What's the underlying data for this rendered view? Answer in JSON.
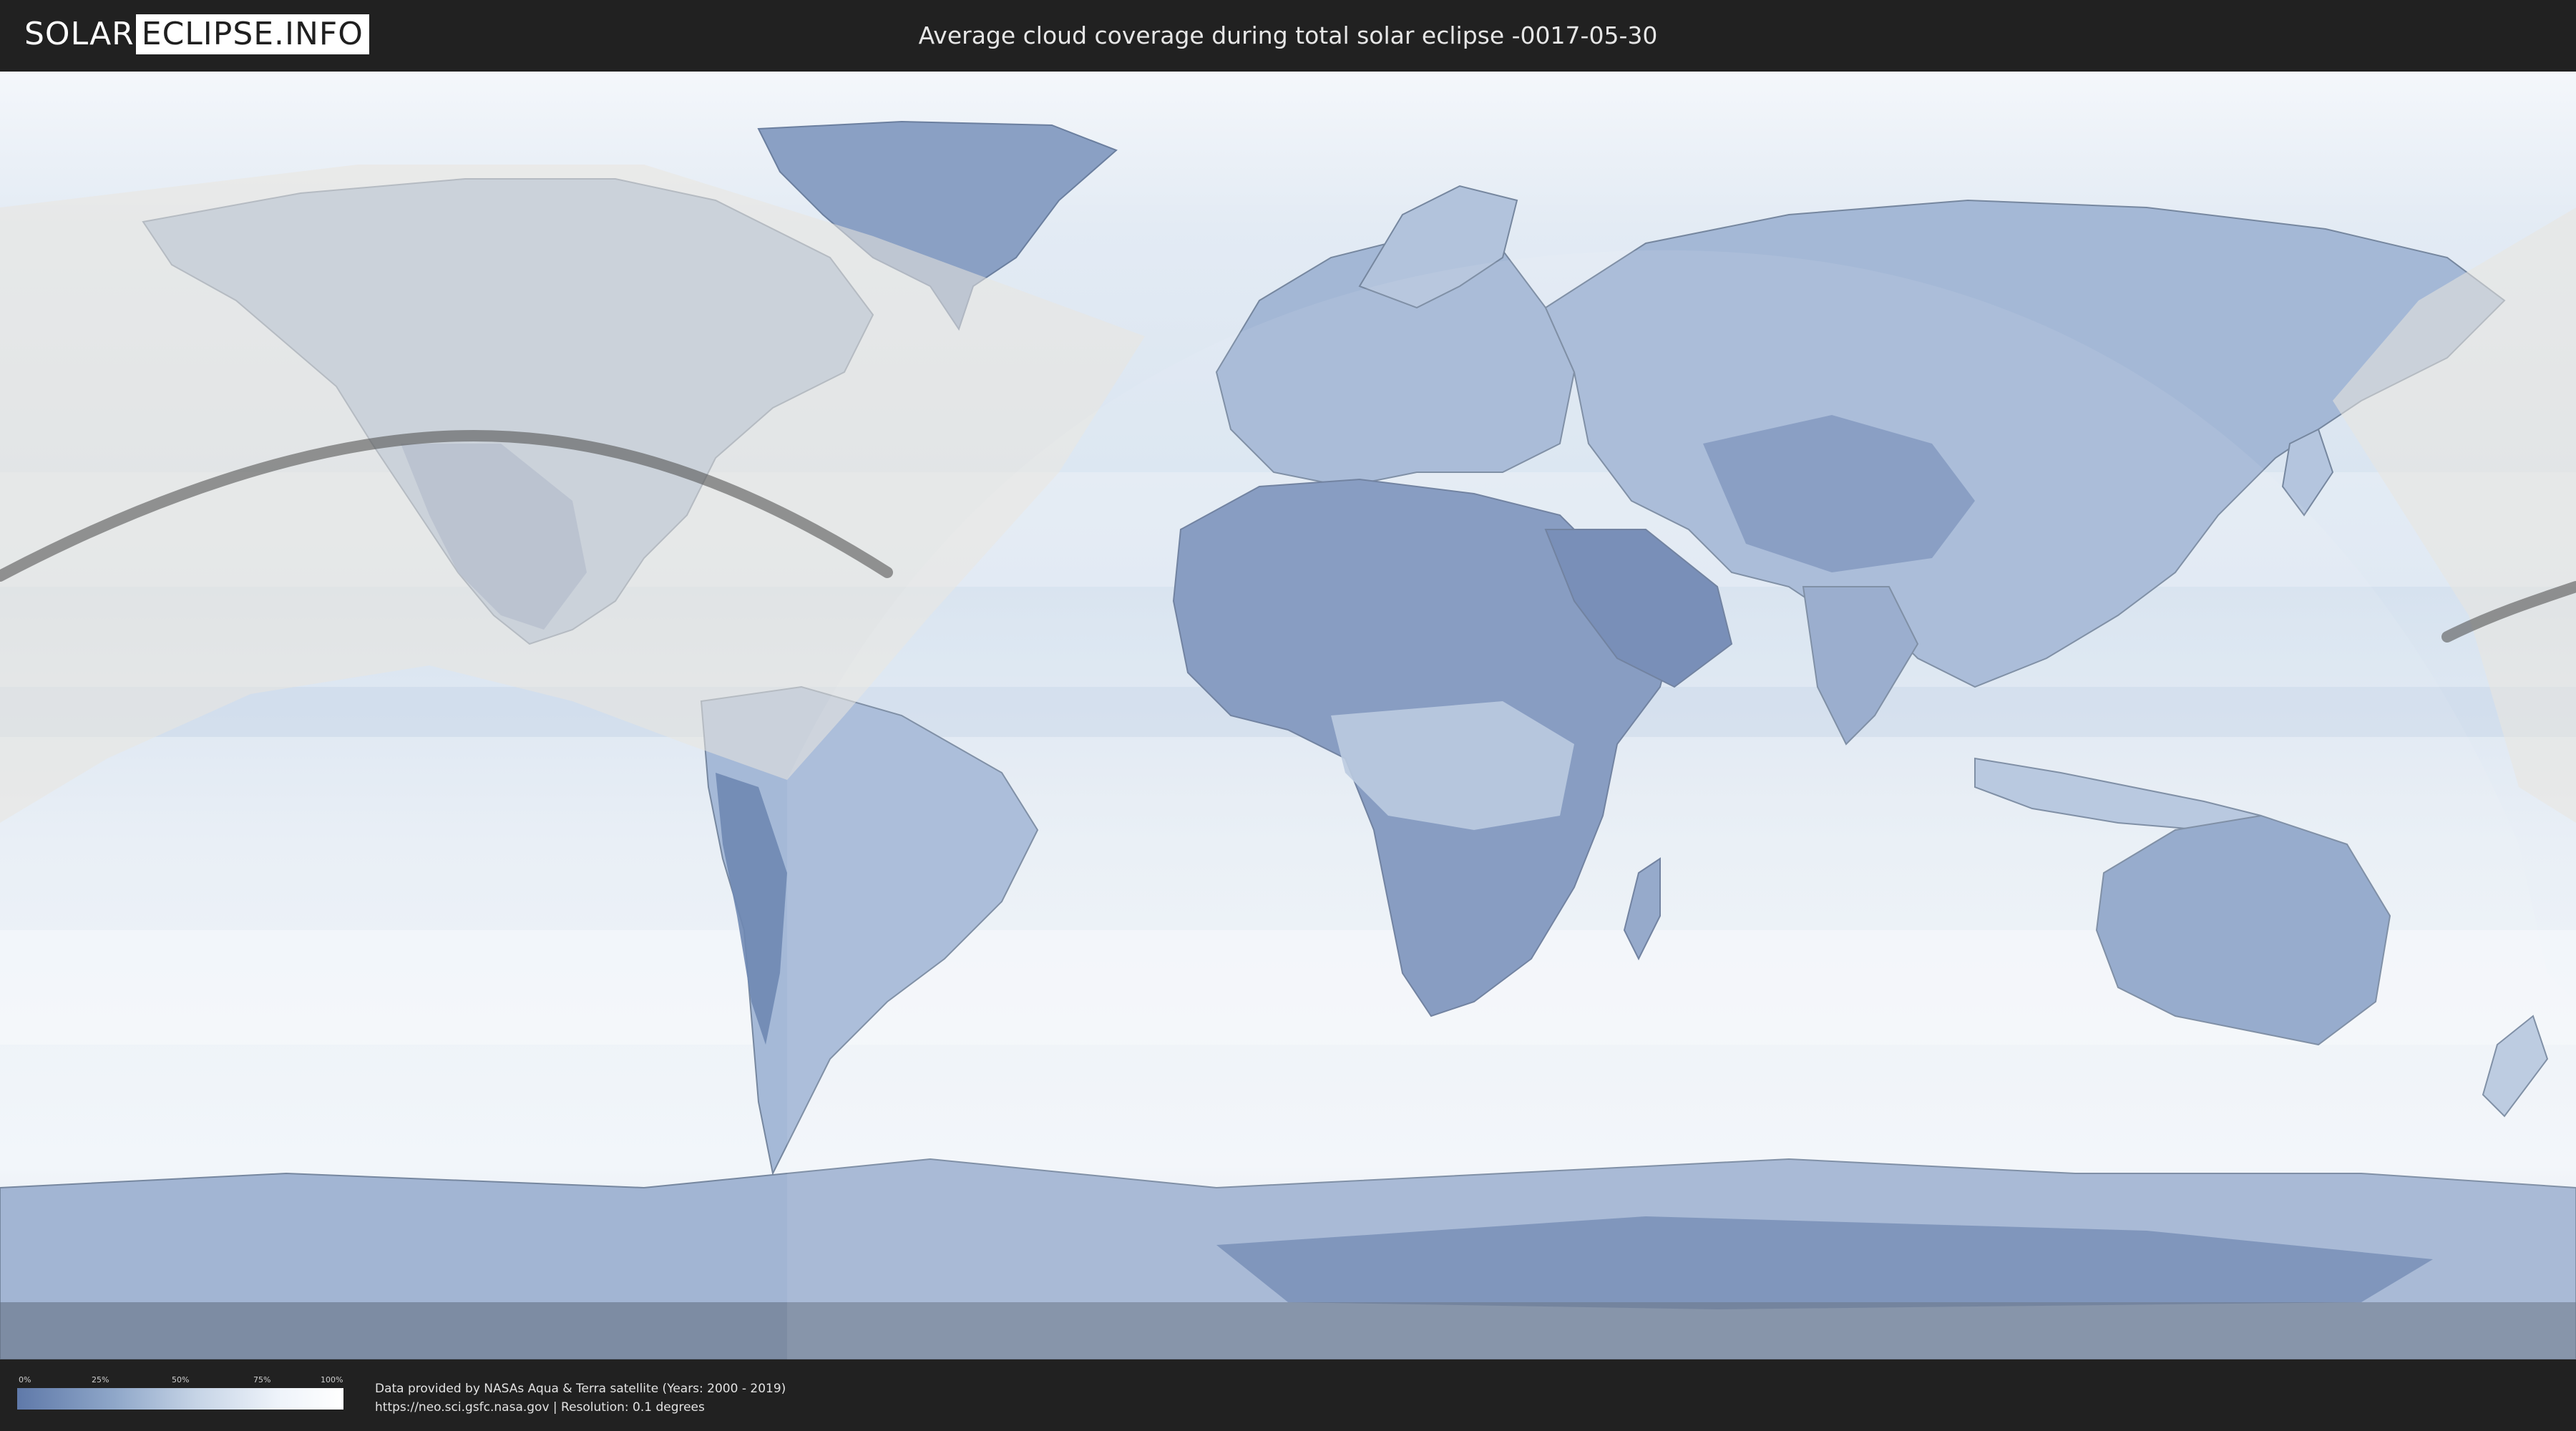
{
  "header": {
    "logo_part1": "SOLAR",
    "logo_part2": "ECLIPSE.INFO",
    "title": "Average cloud coverage during total solar eclipse -0017-05-30"
  },
  "map": {
    "description_layers": [
      "cloud-coverage",
      "country-borders",
      "penumbra-region",
      "totality-path"
    ],
    "colors": {
      "land_cloudless": "#5f79a9",
      "cloud_full": "#ffffff",
      "penumbra_overlay": "#e8e4de",
      "totality_path": "#555555"
    }
  },
  "legend": {
    "ticks": [
      "0%",
      "25%",
      "50%",
      "75%",
      "100%"
    ]
  },
  "footer": {
    "credit_line1": "Data provided by NASAs Aqua & Terra satellite (Years: 2000 - 2019)",
    "credit_line2": "https://neo.sci.gsfc.nasa.gov | Resolution: 0.1 degrees"
  }
}
